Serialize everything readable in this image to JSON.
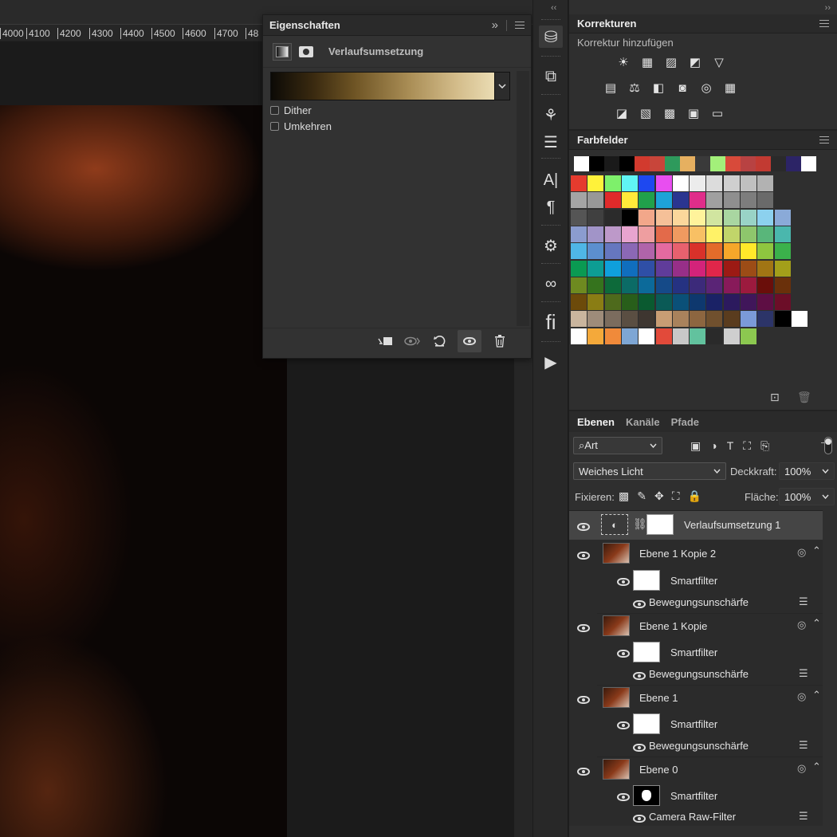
{
  "ruler": {
    "ticks": [
      "4000",
      "4100",
      "4200",
      "4300",
      "4400",
      "4500",
      "4600",
      "4700",
      "48"
    ]
  },
  "properties": {
    "title": "Eigenschaften",
    "header_glyph": "»",
    "mode_label": "Verlaufsumsetzung",
    "options": {
      "dither": "Dither",
      "reverse": "Umkehren"
    },
    "footer_icons": [
      "clip-to-layer-icon",
      "view-previous-icon",
      "reset-icon",
      "visibility-icon",
      "trash-icon"
    ]
  },
  "adjustments": {
    "title": "Korrekturen",
    "subtitle": "Korrektur hinzufügen",
    "rows": [
      [
        "☀",
        "▦",
        "▨",
        "◩",
        "▽"
      ],
      [
        "▤",
        "⚖",
        "◧",
        "◙",
        "◎",
        "▦"
      ],
      [
        "◪",
        "▧",
        "▩",
        "▣",
        "▭"
      ]
    ]
  },
  "swatches": {
    "title": "Farbfelder",
    "recent": [
      "#ffffff",
      "#000000",
      "#1a1a1a",
      "#000000",
      "#d23a2e",
      "#c8453a",
      "#2e9a5c",
      "#e6b060",
      "#3a3a3a",
      "#a3f07a",
      "#d84a3a",
      "#b84242",
      "#c23a32",
      "#2a2a2a",
      "#2c2466",
      "#ffffff"
    ],
    "grid": [
      [
        "#e53b2e",
        "#fff23a",
        "#7ef06b",
        "#60f5f5",
        "#1e48f0",
        "#e84ef0",
        "#ffffff",
        "#ececec",
        "#dcdcdc",
        "#cfcfcf",
        "#c0c0c0",
        "#b2b2b2"
      ],
      [
        "#a4a4a4",
        "#989898",
        "#e02a2a",
        "#ffea3a",
        "#21a04b",
        "#1ea2d8",
        "#2a3590",
        "#e02d8a",
        "#a0a0a0",
        "#8f8f8f",
        "#7d7d7d",
        "#6a6a6a"
      ],
      [
        "#555555",
        "#404040",
        "#2b2b2b",
        "#000000",
        "#f2a78a",
        "#f5c098",
        "#fbd79b",
        "#fff39b",
        "#d1e5a0",
        "#a9d6a1",
        "#99d3c6",
        "#8cd1ee",
        "#8aaad8"
      ],
      [
        "#8b9ccf",
        "#a194c8",
        "#bd99c9",
        "#e8a4cf",
        "#ee9ea0",
        "#e36a4a",
        "#ef9a60",
        "#f8c064",
        "#fff267",
        "#c1d56a",
        "#8ec66c",
        "#59b67a",
        "#4ab7ad"
      ],
      [
        "#4fb6e6",
        "#5c8fcf",
        "#6677bf",
        "#8b68b5",
        "#b064aa",
        "#e46aa0",
        "#e8616e",
        "#d9312a",
        "#e36c2a",
        "#f6a72a",
        "#ffe92a",
        "#8ec63f",
        "#3bb14b"
      ],
      [
        "#0a9a52",
        "#0d9d93",
        "#0fa0dc",
        "#106ebe",
        "#2f4fa6",
        "#603c9a",
        "#972f88",
        "#d3237a",
        "#e0264a",
        "#9c1a14",
        "#9c4c16",
        "#a17514",
        "#a39f1a"
      ],
      [
        "#6e8a20",
        "#35731d",
        "#0d6a3a",
        "#0b6b66",
        "#0c6a9a",
        "#154a88",
        "#253282",
        "#3c2a7a",
        "#5a2476",
        "#881a5a",
        "#9c1a3e",
        "#6a0e0a",
        "#6a300a"
      ],
      [
        "#6c4a0a",
        "#8a7d14",
        "#4e6a1c",
        "#285e1a",
        "#0a5a30",
        "#0a5a56",
        "#0a5078",
        "#0e386e",
        "#1a2266",
        "#2c1a5e",
        "#40165a",
        "#5e0e44",
        "#6c0e28"
      ],
      [
        "#c9b59e",
        "#9e8c7a",
        "#7b6c5e",
        "#5a4e42",
        "#3e3630",
        "#c89d74",
        "#a9825c",
        "#8d6640",
        "#70502e",
        "#5a3c1e",
        "#7b9ad8",
        "#2c3468",
        "#000000",
        "#ffffff"
      ],
      [
        "#ffffff",
        "#f4a93a",
        "#f08a3a",
        "#7ea6d4",
        "#ffffff",
        "#e24a3a",
        "#c8c8c8",
        "#62c29e",
        "#2a2a2a",
        "#cfcfcf",
        "#8cc850"
      ]
    ]
  },
  "layers": {
    "tabs": [
      "Ebenen",
      "Kanäle",
      "Pfade"
    ],
    "filter_kind": "Art",
    "blend_mode": "Weiches Licht",
    "opacity_label": "Deckkraft:",
    "opacity_value": "100%",
    "lock_label": "Fixieren:",
    "fill_label": "Fläche:",
    "fill_value": "100%",
    "items": [
      {
        "name": "Verlaufsumsetzung 1"
      },
      {
        "name": "Ebene 1 Kopie 2",
        "filter": "Smartfilter",
        "sub": "Bewegungsunschärfe"
      },
      {
        "name": "Ebene 1 Kopie",
        "filter": "Smartfilter",
        "sub": "Bewegungsunschärfe"
      },
      {
        "name": "Ebene 1",
        "filter": "Smartfilter",
        "sub": "Bewegungsunschärfe"
      },
      {
        "name": "Ebene 0",
        "filter": "Smartfilter",
        "sub": "Camera Raw-Filter"
      }
    ]
  },
  "tool_strip_icons": [
    "libraries-icon",
    "3d-icon",
    "brush-settings-icon",
    "adjust-sliders-icon",
    "character-icon",
    "paragraph-icon",
    "glyph-settings-icon",
    "creative-cloud-icon",
    "glyphs-icon",
    "play-actions-icon"
  ]
}
